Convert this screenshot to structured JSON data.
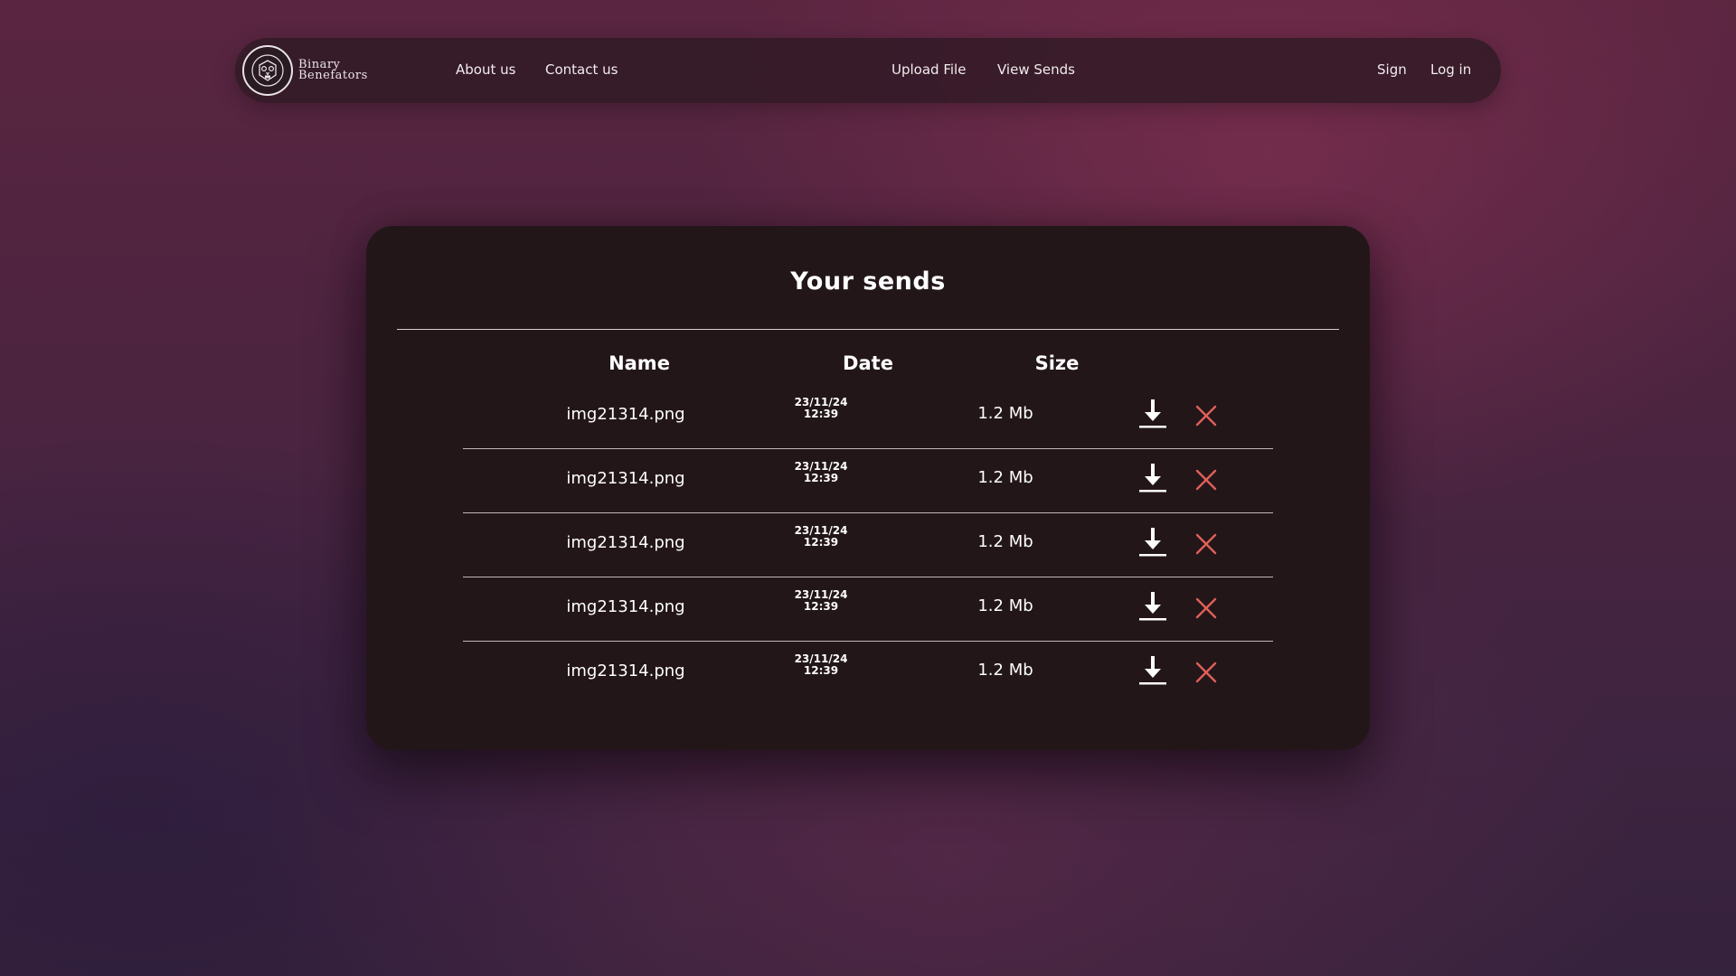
{
  "nav": {
    "brand_line1": "Binary",
    "brand_line2": "Benefators",
    "about": "About us",
    "contact": "Contact us",
    "upload": "Upload File",
    "view_sends": "View Sends",
    "sign": "Sign",
    "login": "Log in"
  },
  "card": {
    "title": "Your sends",
    "headers": {
      "name": "Name",
      "date": "Date",
      "size": "Size"
    },
    "rows": [
      {
        "name": "img21314.png",
        "date": "23/11/24",
        "time": "12:39",
        "size": "1.2 Mb"
      },
      {
        "name": "img21314.png",
        "date": "23/11/24",
        "time": "12:39",
        "size": "1.2 Mb"
      },
      {
        "name": "img21314.png",
        "date": "23/11/24",
        "time": "12:39",
        "size": "1.2 Mb"
      },
      {
        "name": "img21314.png",
        "date": "23/11/24",
        "time": "12:39",
        "size": "1.2 Mb"
      },
      {
        "name": "img21314.png",
        "date": "23/11/24",
        "time": "12:39",
        "size": "1.2 Mb"
      }
    ]
  },
  "icons": {
    "logo": "owl-crest-icon",
    "download": "download-icon",
    "delete": "close-icon"
  },
  "colors": {
    "delete_icon": "#e0605a",
    "card_background": "#231619",
    "navbar_background": "#2d1822"
  }
}
